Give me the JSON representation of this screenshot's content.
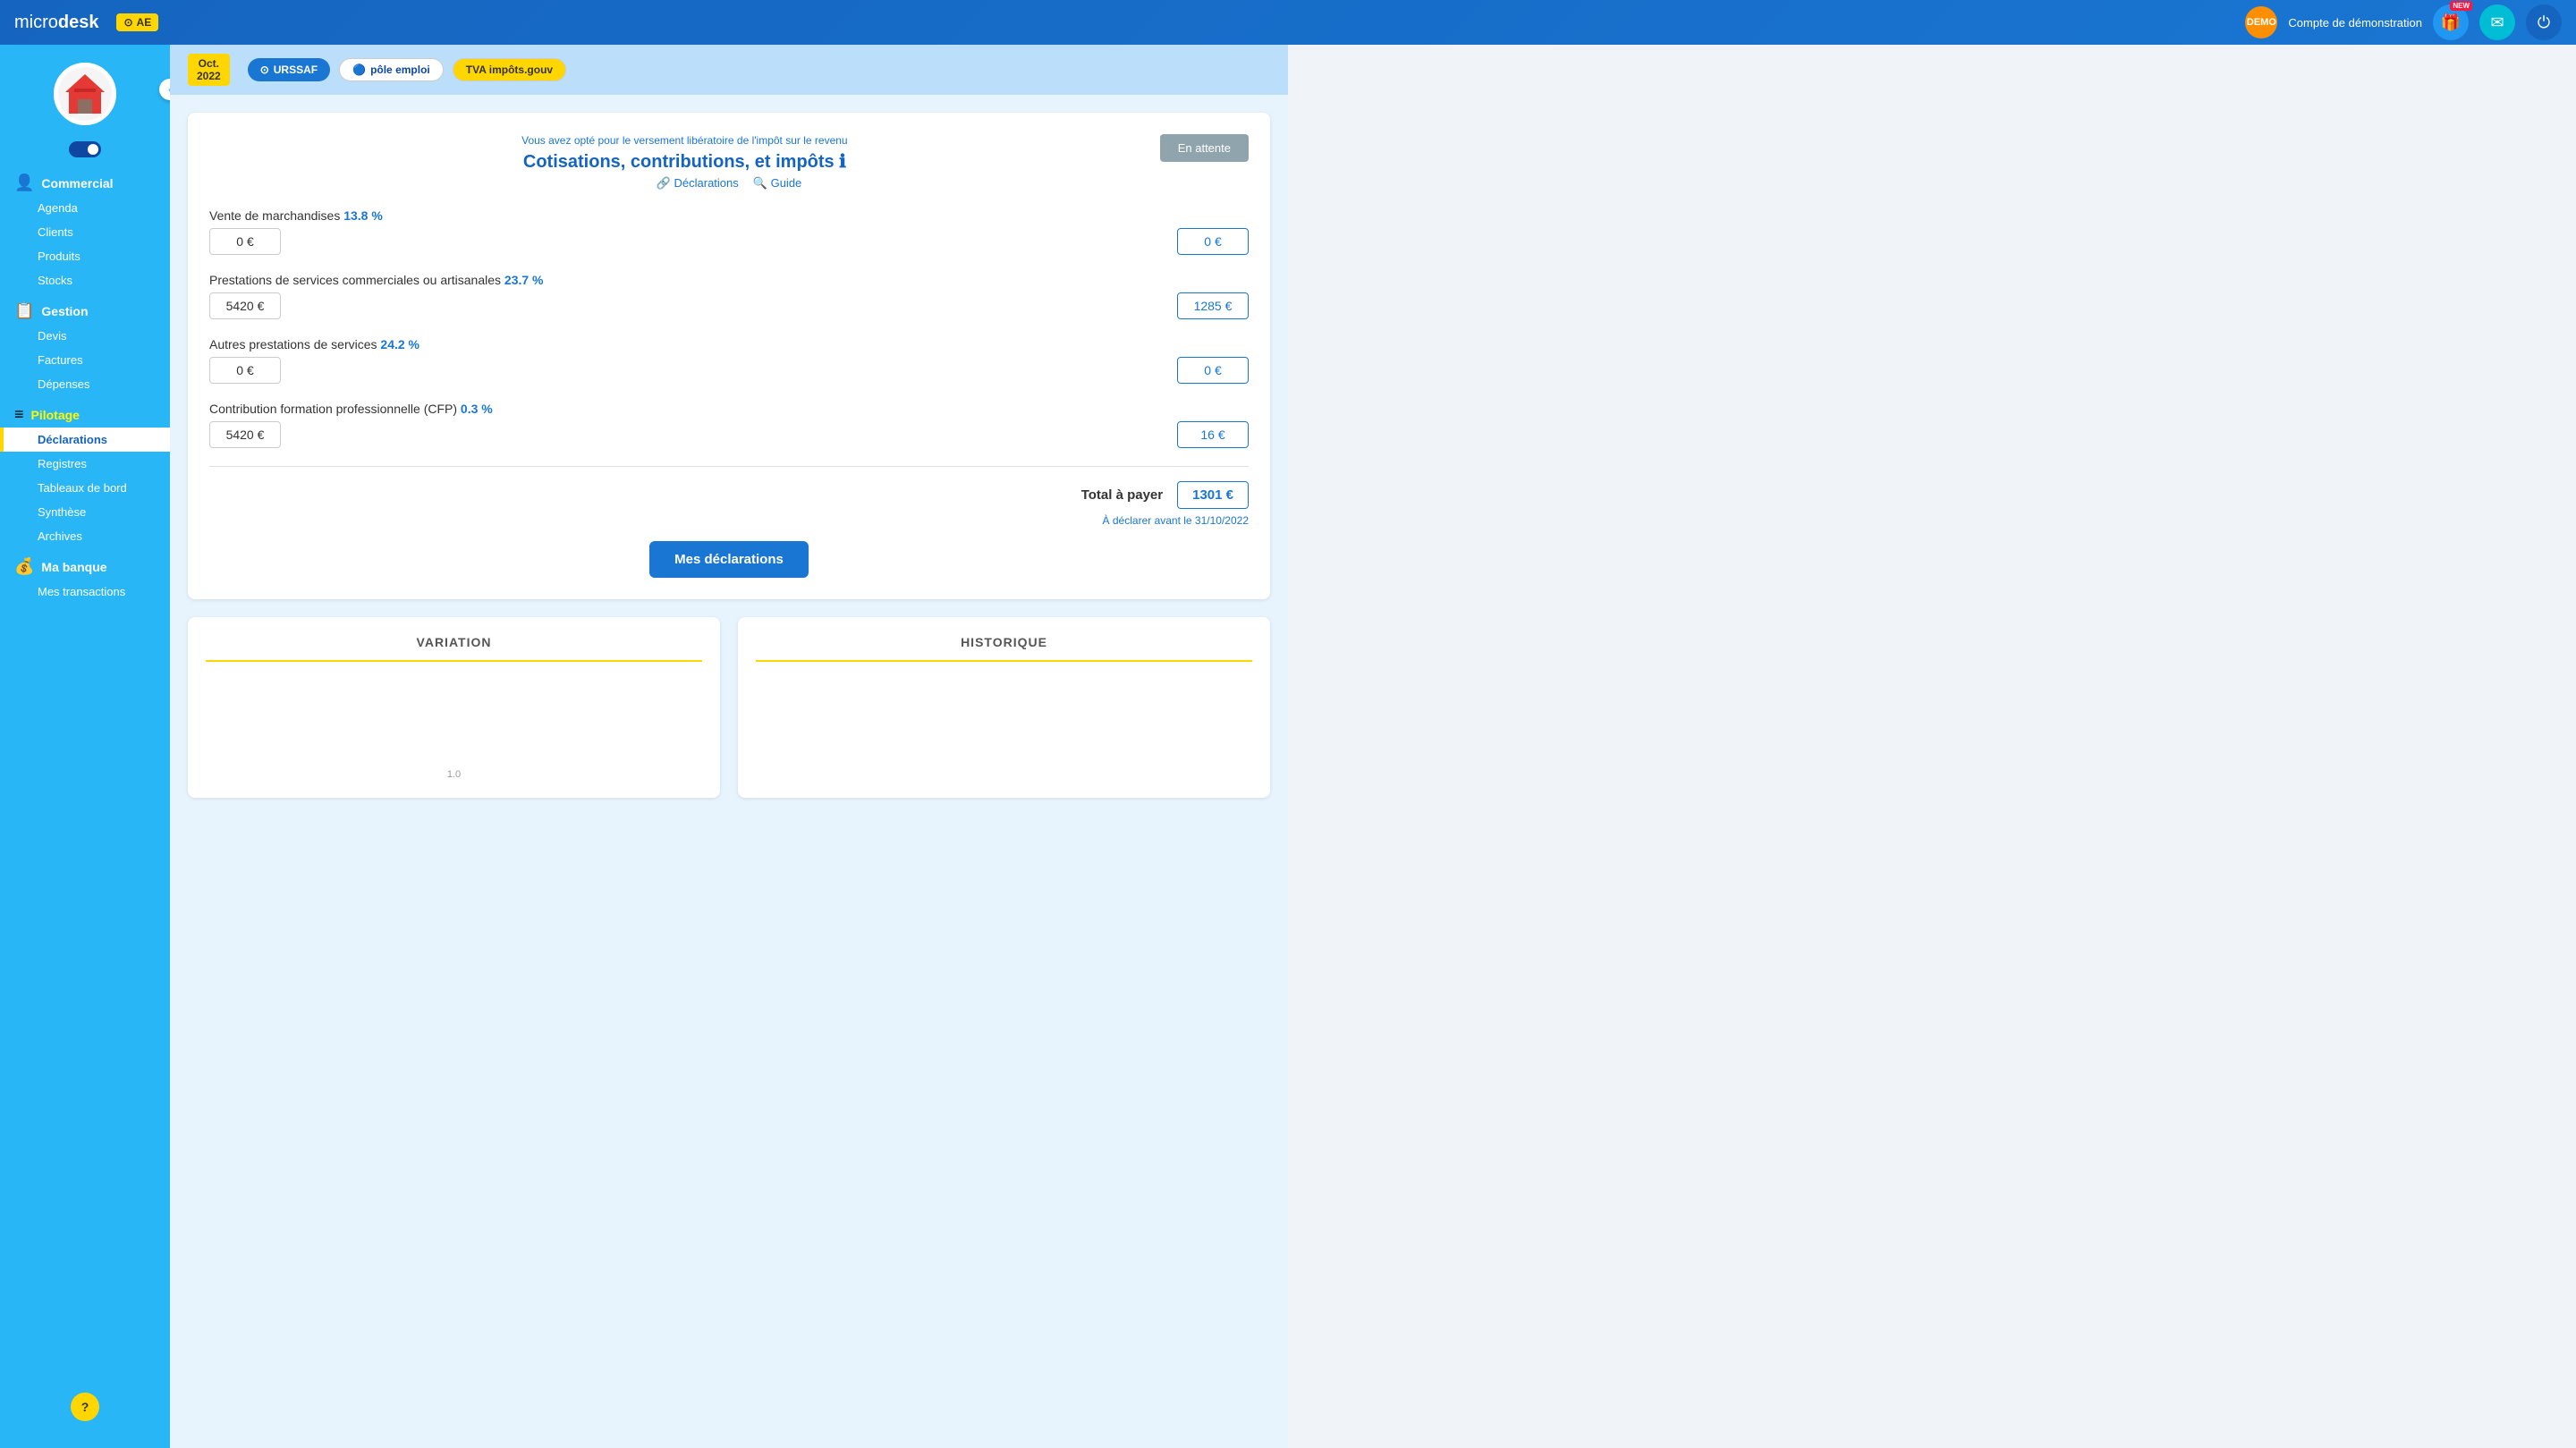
{
  "app": {
    "logo_light": "micro",
    "logo_bold": "desk",
    "ae_label": "AE"
  },
  "topnav": {
    "demo_label": "DEMO",
    "account_name": "Compte de démonstration",
    "new_badge": "NEW",
    "power_icon": "⏻",
    "mail_icon": "✉",
    "gift_icon": "🎁"
  },
  "sidebar": {
    "toggle_state": "on",
    "sections": [
      {
        "id": "commercial",
        "icon": "👤",
        "label": "Commercial",
        "active": false,
        "items": [
          {
            "id": "agenda",
            "label": "Agenda",
            "active": false
          },
          {
            "id": "clients",
            "label": "Clients",
            "active": false
          },
          {
            "id": "produits",
            "label": "Produits",
            "active": false
          },
          {
            "id": "stocks",
            "label": "Stocks",
            "active": false
          }
        ]
      },
      {
        "id": "gestion",
        "icon": "📋",
        "label": "Gestion",
        "active": false,
        "items": [
          {
            "id": "devis",
            "label": "Devis",
            "active": false
          },
          {
            "id": "factures",
            "label": "Factures",
            "active": false
          },
          {
            "id": "depenses",
            "label": "Dépenses",
            "active": false
          }
        ]
      },
      {
        "id": "pilotage",
        "icon": "≡",
        "label": "Pilotage",
        "active": true,
        "items": [
          {
            "id": "declarations",
            "label": "Déclarations",
            "active": true
          },
          {
            "id": "registres",
            "label": "Registres",
            "active": false
          },
          {
            "id": "tableaux-de-bord",
            "label": "Tableaux de bord",
            "active": false
          },
          {
            "id": "synthese",
            "label": "Synthèse",
            "active": false
          },
          {
            "id": "archives",
            "label": "Archives",
            "active": false
          }
        ]
      },
      {
        "id": "ma-banque",
        "icon": "💰",
        "label": "Ma banque",
        "active": false,
        "items": [
          {
            "id": "mes-transactions",
            "label": "Mes transactions",
            "active": false
          }
        ]
      }
    ],
    "help_label": "?"
  },
  "date_nav": {
    "month": "Oct.",
    "year": "2022",
    "orgs": [
      {
        "id": "urssaf",
        "label": "URSSAF",
        "class": "urssaf"
      },
      {
        "id": "pole-emploi",
        "label": "pôle emploi",
        "class": "pole-emploi"
      },
      {
        "id": "tva",
        "label": "TVA impôts.gouv",
        "class": "tva"
      }
    ]
  },
  "main": {
    "en_attente": "En attente",
    "info_subtitle": "Vous avez opté pour le versement libératoire de l'impôt sur le revenu",
    "info_title": "Cotisations, contributions, et impôts ℹ",
    "link_declarations": "Déclarations",
    "link_guide": "Guide",
    "rows": [
      {
        "id": "vente",
        "label": "Vente de marchandises",
        "rate": "13.8 %",
        "input_value": "0 €",
        "result_value": "0 €"
      },
      {
        "id": "prestations",
        "label": "Prestations de services commerciales ou artisanales",
        "rate": "23.7 %",
        "input_value": "5420 €",
        "result_value": "1285 €"
      },
      {
        "id": "autres",
        "label": "Autres prestations de services",
        "rate": "24.2 %",
        "input_value": "0 €",
        "result_value": "0 €"
      },
      {
        "id": "cfp",
        "label": "Contribution formation professionnelle (CFP)",
        "rate": "0.3 %",
        "input_value": "5420 €",
        "result_value": "16 €"
      }
    ],
    "total_label": "Total à payer",
    "total_value": "1301 €",
    "declare_note": "À déclarer avant le 31/10/2022",
    "mes_declarations_btn": "Mes déclarations"
  },
  "charts": {
    "variation_title": "VARIATION",
    "historique_title": "HISTORIQUE",
    "y_axis_label": "1.0"
  }
}
